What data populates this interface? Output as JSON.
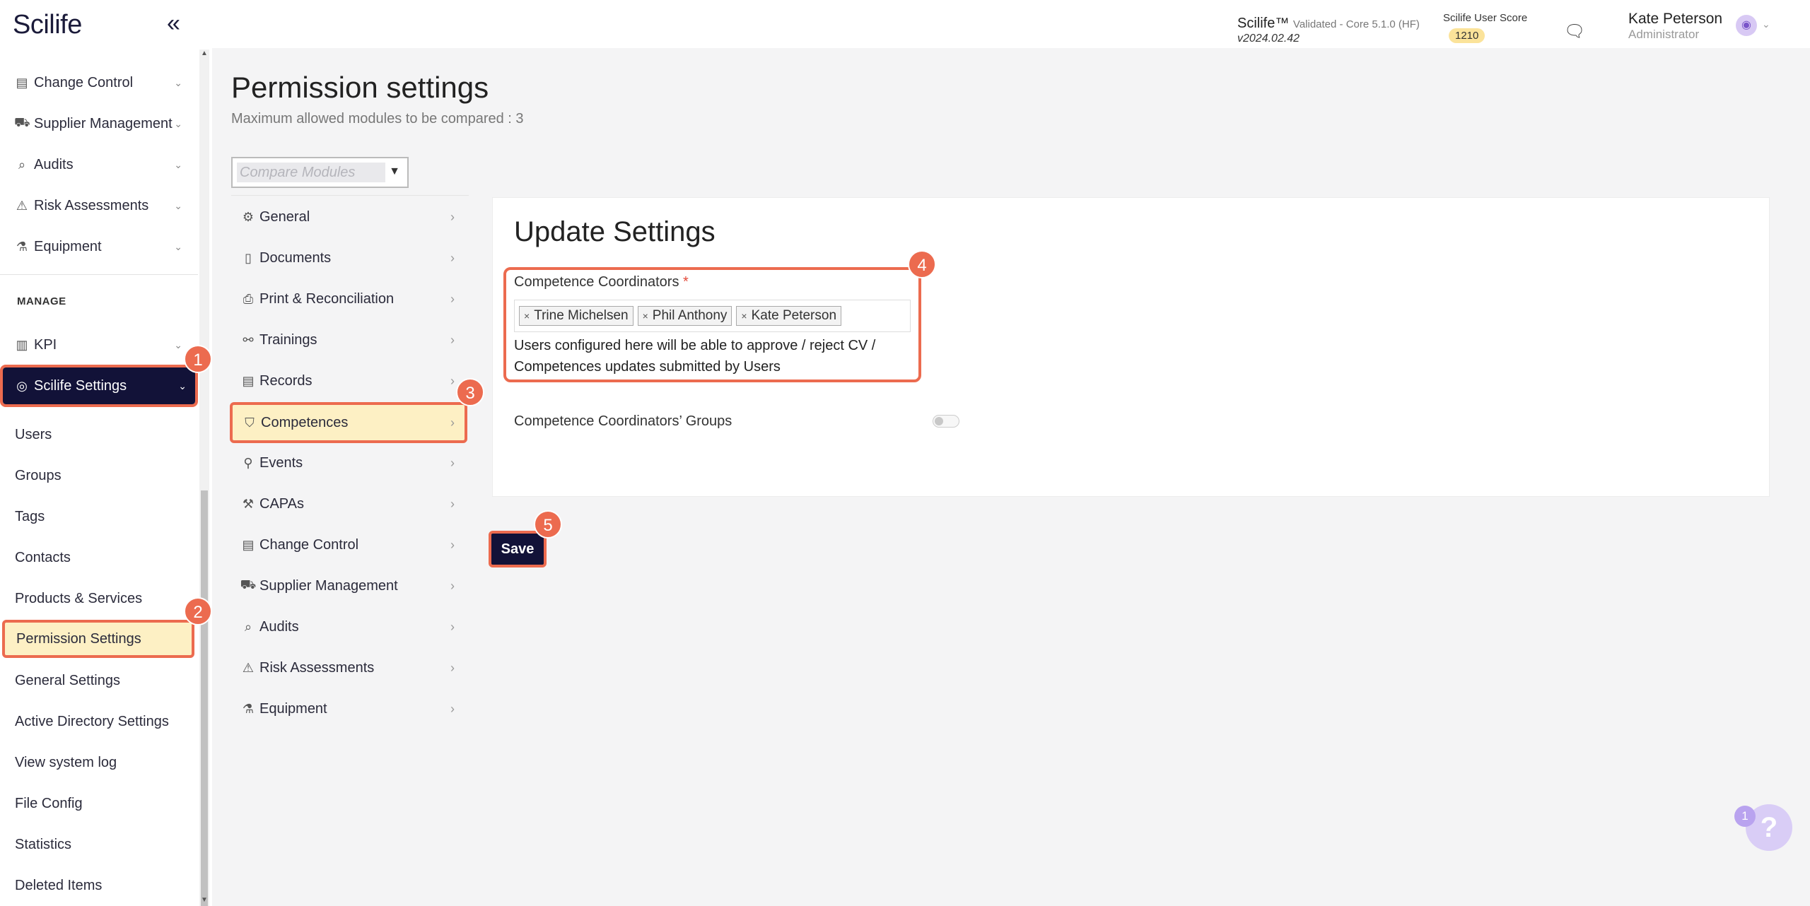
{
  "brand": "Scilife",
  "sidebar": {
    "modules": [
      {
        "label": "Change Control",
        "icon": "change-control-icon"
      },
      {
        "label": "Supplier Management",
        "icon": "supplier-icon"
      },
      {
        "label": "Audits",
        "icon": "audits-icon"
      },
      {
        "label": "Risk Assessments",
        "icon": "risk-icon"
      },
      {
        "label": "Equipment",
        "icon": "equipment-icon"
      }
    ],
    "section_title": "MANAGE",
    "kpi_label": "KPI",
    "settings_label": "Scilife Settings",
    "settings_items": [
      "Users",
      "Groups",
      "Tags",
      "Contacts",
      "Products & Services",
      "Permission Settings",
      "General Settings",
      "Active Directory Settings",
      "View system log",
      "File Config",
      "Statistics",
      "Deleted Items"
    ]
  },
  "header": {
    "product": "Scilife™",
    "validated": "Validated - Core 5.1.0 (HF)",
    "version": "v2024.02.42",
    "score_label": "Scilife User Score",
    "score": "1210",
    "user_name": "Kate Peterson",
    "user_role": "Administrator"
  },
  "main": {
    "title": "Permission settings",
    "subtitle": "Maximum allowed modules to be compared : 3",
    "compare_placeholder": "Compare Modules",
    "nav": [
      {
        "label": "General",
        "icon": "gear-icon"
      },
      {
        "label": "Documents",
        "icon": "document-icon"
      },
      {
        "label": "Print & Reconciliation",
        "icon": "print-icon"
      },
      {
        "label": "Trainings",
        "icon": "training-icon"
      },
      {
        "label": "Records",
        "icon": "records-icon"
      },
      {
        "label": "Competences",
        "icon": "competences-icon"
      },
      {
        "label": "Events",
        "icon": "events-icon"
      },
      {
        "label": "CAPAs",
        "icon": "capas-icon"
      },
      {
        "label": "Change Control",
        "icon": "change-control-icon"
      },
      {
        "label": "Supplier Management",
        "icon": "supplier-icon"
      },
      {
        "label": "Audits",
        "icon": "audits-icon"
      },
      {
        "label": "Risk Assessments",
        "icon": "risk-icon"
      },
      {
        "label": "Equipment",
        "icon": "equipment-icon"
      }
    ]
  },
  "settings": {
    "title": "Update Settings",
    "coordinators_label": "Competence Coordinators",
    "required_mark": "*",
    "coordinators": [
      "Trine Michelsen",
      "Phil Anthony",
      "Kate Peterson"
    ],
    "help_text": "Users configured here will be able to approve / reject CV / Competences updates submitted by Users",
    "groups_label": "Competence Coordinators’ Groups",
    "groups_enabled": false,
    "save_label": "Save"
  },
  "callouts": [
    "1",
    "2",
    "3",
    "4",
    "5"
  ],
  "help_widget": {
    "label": "?",
    "count": "1"
  },
  "colors": {
    "accent": "#ec6b4f",
    "navy": "#121238",
    "highlight": "#fdf0c4"
  }
}
